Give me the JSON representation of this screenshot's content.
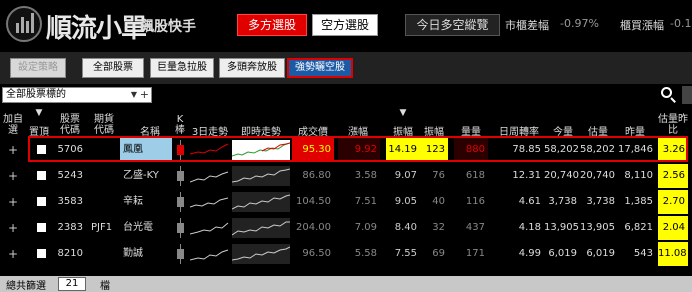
{
  "app": {
    "title": "順流小單",
    "subtitle": "飆股快手"
  },
  "top": {
    "long_btn": "多方選股",
    "short_btn": "空方選股",
    "sentiment_btn": "今日多空縱覽",
    "market_diff_label": "市櫃差幅",
    "market_diff_value": "-0.97%",
    "otc_rise_label": "櫃買漲幅",
    "otc_rise_value": "-0.1"
  },
  "strategy": {
    "buttons": [
      {
        "label": "設定策略",
        "state": "disabled"
      },
      {
        "label": "全部股票",
        "state": "normal"
      },
      {
        "label": "巨量急拉股",
        "state": "normal"
      },
      {
        "label": "多頭奔放股",
        "state": "normal"
      },
      {
        "label": "強勢曬空股",
        "state": "active"
      }
    ]
  },
  "filter": {
    "selected": "全部股票標的",
    "arrow": "▼",
    "plus": "+"
  },
  "table": {
    "headers": {
      "add": "加自選",
      "top": "置頂",
      "stock_code": "股票代碼",
      "futures_code": "期貨代碼",
      "name": "名稱",
      "k": "K棒",
      "trend3": "3日走勢",
      "intraday": "即時走勢",
      "price": "成交價",
      "change": "漲幅",
      "amplitude": "振幅",
      "amplitude2": "振幅",
      "volume": "量量",
      "turnover": "日周轉率",
      "vol_today": "今量",
      "vol_est": "估量",
      "vol_yday": "昨量",
      "est_ratio": "估量昨比"
    },
    "sort_indicator": "▼",
    "rows": [
      {
        "code": "5706",
        "fut": "",
        "name": "鳳凰",
        "price": "95.30",
        "change": "9.92",
        "amp": "14.19",
        "amp2": "123",
        "qty": "880",
        "turnover": "78.85",
        "vol": "58,202",
        "est": "58,202",
        "yday": "17,846",
        "ratio": "3.26",
        "k_color": "#e00000",
        "highlight": true
      },
      {
        "code": "5243",
        "fut": "",
        "name": "乙盛-KY",
        "price": "86.80",
        "change": "3.58",
        "amp": "9.07",
        "amp2": "76",
        "qty": "618",
        "turnover": "12.31",
        "vol": "20,740",
        "est": "20,740",
        "yday": "8,110",
        "ratio": "2.56",
        "k_color": "#888888",
        "highlight": false
      },
      {
        "code": "3583",
        "fut": "",
        "name": "辛耘",
        "price": "104.50",
        "change": "7.51",
        "amp": "9.05",
        "amp2": "40",
        "qty": "116",
        "turnover": "4.61",
        "vol": "3,738",
        "est": "3,738",
        "yday": "1,385",
        "ratio": "2.70",
        "k_color": "#888888",
        "highlight": false
      },
      {
        "code": "2383",
        "fut": "PJF1",
        "name": "台光電",
        "price": "204.00",
        "change": "7.09",
        "amp": "8.40",
        "amp2": "32",
        "qty": "437",
        "turnover": "4.18",
        "vol": "13,905",
        "est": "13,905",
        "yday": "6,821",
        "ratio": "2.04",
        "k_color": "#888888",
        "highlight": false
      },
      {
        "code": "8210",
        "fut": "",
        "name": "勤誠",
        "price": "96.50",
        "change": "5.58",
        "amp": "7.55",
        "amp2": "69",
        "qty": "171",
        "turnover": "4.99",
        "vol": "6,019",
        "est": "6,019",
        "yday": "543",
        "ratio": "11.08",
        "k_color": "#888888",
        "highlight": false
      }
    ]
  },
  "bottom": {
    "total_label": "總共篩選",
    "total_count": "21",
    "unit": "檔"
  },
  "colors": {
    "red": "#e00000",
    "yellow": "#ffff00",
    "active_blue": "#1c5aa6"
  }
}
